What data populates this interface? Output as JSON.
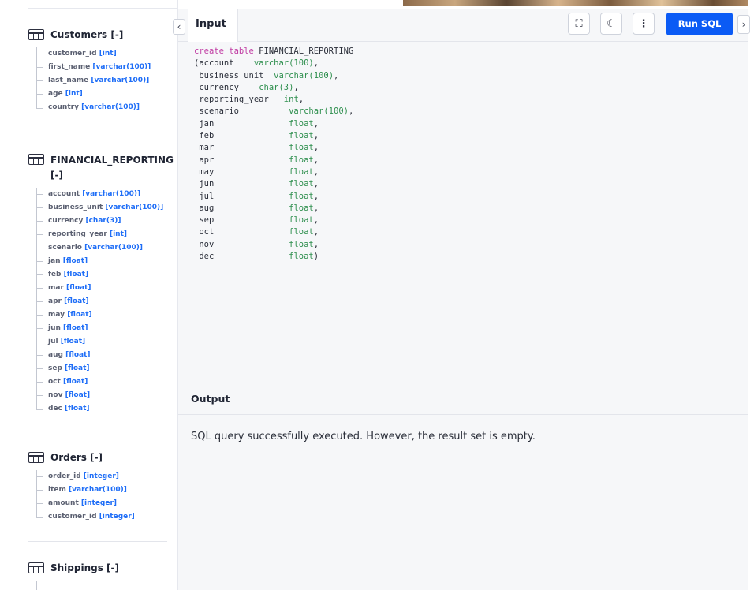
{
  "sidebar": {
    "tables": [
      {
        "title": "Customers [-]",
        "columns": [
          {
            "name": "customer_id",
            "type": "[int]"
          },
          {
            "name": "first_name",
            "type": "[varchar(100)]"
          },
          {
            "name": "last_name",
            "type": "[varchar(100)]"
          },
          {
            "name": "age",
            "type": "[int]"
          },
          {
            "name": "country",
            "type": "[varchar(100)]"
          }
        ]
      },
      {
        "title": "FINANCIAL_REPORTING [-]",
        "columns": [
          {
            "name": "account",
            "type": "[varchar(100)]"
          },
          {
            "name": "business_unit",
            "type": "[varchar(100)]"
          },
          {
            "name": "currency",
            "type": "[char(3)]"
          },
          {
            "name": "reporting_year",
            "type": "[int]"
          },
          {
            "name": "scenario",
            "type": "[varchar(100)]"
          },
          {
            "name": "jan",
            "type": "[float]"
          },
          {
            "name": "feb",
            "type": "[float]"
          },
          {
            "name": "mar",
            "type": "[float]"
          },
          {
            "name": "apr",
            "type": "[float]"
          },
          {
            "name": "may",
            "type": "[float]"
          },
          {
            "name": "jun",
            "type": "[float]"
          },
          {
            "name": "jul",
            "type": "[float]"
          },
          {
            "name": "aug",
            "type": "[float]"
          },
          {
            "name": "sep",
            "type": "[float]"
          },
          {
            "name": "oct",
            "type": "[float]"
          },
          {
            "name": "nov",
            "type": "[float]"
          },
          {
            "name": "dec",
            "type": "[float]"
          }
        ]
      },
      {
        "title": "Orders [-]",
        "columns": [
          {
            "name": "order_id",
            "type": "[integer]"
          },
          {
            "name": "item",
            "type": "[varchar(100)]"
          },
          {
            "name": "amount",
            "type": "[integer]"
          },
          {
            "name": "customer_id",
            "type": "[integer]"
          }
        ]
      },
      {
        "title": "Shippings [-]",
        "columns": []
      }
    ]
  },
  "editor": {
    "tab_label": "Input",
    "run_label": "Run SQL",
    "icons": {
      "collapse_left": "‹",
      "fullscreen": "⛶",
      "theme": "☾",
      "more": "⋮",
      "collapse_right": "›"
    },
    "code": {
      "kw1": "create table",
      "name": " FINANCIAL_REPORTING",
      "lines": [
        {
          "col": "(account    ",
          "type": "varchar(100)",
          "tail": ","
        },
        {
          "col": " business_unit  ",
          "type": "varchar(100)",
          "tail": ","
        },
        {
          "col": " currency    ",
          "type": "char(3)",
          "tail": ","
        },
        {
          "col": " reporting_year   ",
          "type": "int",
          "tail": ","
        },
        {
          "col": " scenario          ",
          "type": "varchar(100)",
          "tail": ","
        },
        {
          "col": " jan               ",
          "type": "float",
          "tail": ","
        },
        {
          "col": " feb               ",
          "type": "float",
          "tail": ","
        },
        {
          "col": " mar               ",
          "type": "float",
          "tail": ","
        },
        {
          "col": " apr               ",
          "type": "float",
          "tail": ","
        },
        {
          "col": " may               ",
          "type": "float",
          "tail": ","
        },
        {
          "col": " jun               ",
          "type": "float",
          "tail": ","
        },
        {
          "col": " jul               ",
          "type": "float",
          "tail": ","
        },
        {
          "col": " aug               ",
          "type": "float",
          "tail": ","
        },
        {
          "col": " sep               ",
          "type": "float",
          "tail": ","
        },
        {
          "col": " oct               ",
          "type": "float",
          "tail": ","
        },
        {
          "col": " nov               ",
          "type": "float",
          "tail": ","
        },
        {
          "col": " dec               ",
          "type": "float",
          "tail": ")"
        }
      ]
    }
  },
  "output": {
    "title": "Output",
    "message": "SQL query successfully executed. However, the result set is empty."
  },
  "colors": {
    "accent": "#0b5bf5",
    "type_link": "#1f6ef7",
    "keyword": "#c13ea4",
    "sql_type": "#2e8f4e"
  }
}
